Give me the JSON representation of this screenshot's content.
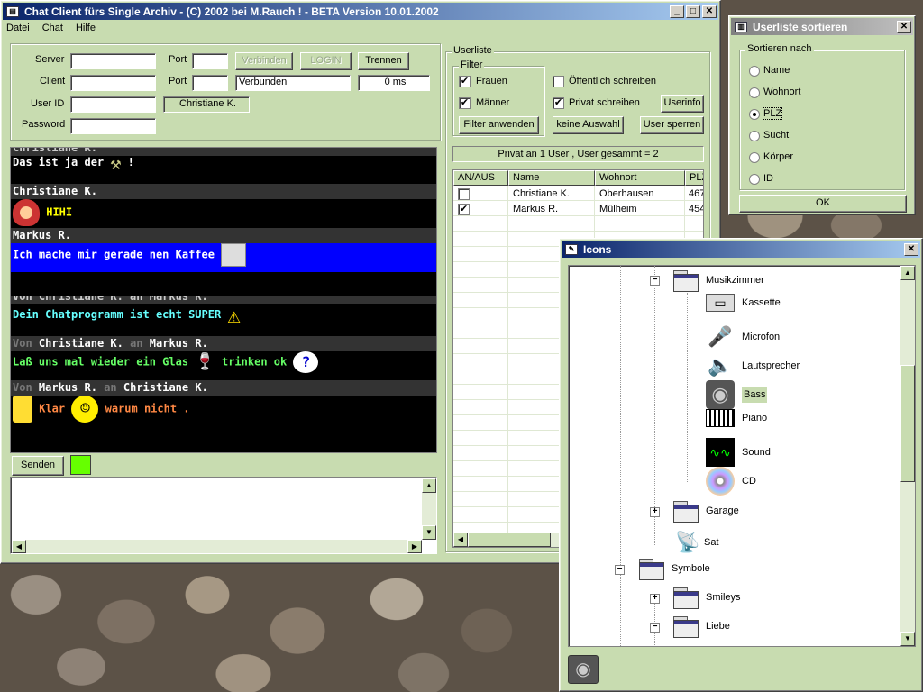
{
  "main": {
    "title": "Chat Client fürs Single Archiv - (C) 2002 bei M.Rauch ! - BETA Version 10.01.2002",
    "menu": [
      "Datei",
      "Chat",
      "Hilfe"
    ],
    "labels": {
      "server": "Server",
      "client": "Client",
      "userid": "User ID",
      "password": "Password",
      "port1": "Port",
      "port2": "Port"
    },
    "fields": {
      "server": "",
      "client": "",
      "userid": "",
      "password": "",
      "port1": "",
      "port2": "",
      "status": "Verbunden",
      "ping": "0 ms",
      "user_display": "Christiane K."
    },
    "buttons": {
      "verbinden": "Verbinden",
      "login": "LOGIN",
      "trennen": "Trennen",
      "senden": "Senden"
    }
  },
  "chat": {
    "partial_top": "Christiane K.",
    "msg1": "Das ist ja der",
    "msg1_end": "!",
    "hdr2": "Christiane K.",
    "msg2": "HIHI",
    "hdr3": "Markus R.",
    "msg3": "Ich mache mir gerade nen Kaffee",
    "partial_mid": "Von Christiane K. an Markus R.",
    "msg4": "Dein Chatprogramm ist echt SUPER",
    "hdr5_von": "Von",
    "hdr5_name": "Christiane K.",
    "hdr5_an": "an",
    "hdr5_to": "Markus R.",
    "msg5": "Laß uns mal wieder ein Glas",
    "msg5_end": "trinken ok",
    "hdr6_von": "Von",
    "hdr6_name": "Markus R.",
    "hdr6_an": "an",
    "hdr6_to": "Christiane K.",
    "msg6a": "Klar",
    "msg6b": "warum nicht .",
    "input_text": ""
  },
  "userliste": {
    "title": "Userliste",
    "filter_title": "Filter",
    "frauen": "Frauen",
    "maenner": "Männer",
    "oeffentlich": "Öffentlich schreiben",
    "privat": "Privat schreiben",
    "btn_userinfo": "Userinfo",
    "btn_filter": "Filter anwenden",
    "btn_keine": "keine Auswahl",
    "btn_sperren": "User sperren",
    "status": "Privat an 1 User , User gesammt = 2",
    "columns": [
      "AN/AUS",
      "Name",
      "Wohnort",
      "PLZ"
    ],
    "rows": [
      {
        "checked": false,
        "name": "Christiane K.",
        "wohnort": "Oberhausen",
        "plz": "467"
      },
      {
        "checked": true,
        "name": "Markus R.",
        "wohnort": "Mülheim",
        "plz": "454"
      }
    ]
  },
  "sort": {
    "title": "Userliste sortieren",
    "group": "Sortieren nach",
    "options": [
      "Name",
      "Wohnort",
      "PLZ",
      "Sucht",
      "Körper",
      "ID"
    ],
    "selected": "PLZ",
    "ok": "OK"
  },
  "icons": {
    "title": "Icons",
    "tree": {
      "musikzimmer": "Musikzimmer",
      "kassette": "Kassette",
      "microfon": "Microfon",
      "lautsprecher": "Lautsprecher",
      "bass": "Bass",
      "piano": "Piano",
      "sound": "Sound",
      "cd": "CD",
      "garage": "Garage",
      "sat": "Sat",
      "symbole": "Symbole",
      "smileys": "Smileys",
      "liebe": "Liebe"
    },
    "selected": "Bass"
  },
  "colors": {
    "window_bg": "#c8dcb0",
    "title_active": "#0a246a",
    "title_gradient_end": "#a6caf0",
    "title_inactive": "#808080",
    "chat_bg": "#000000",
    "highlight_blue": "#0000ff",
    "status_green": "#66ff00"
  }
}
